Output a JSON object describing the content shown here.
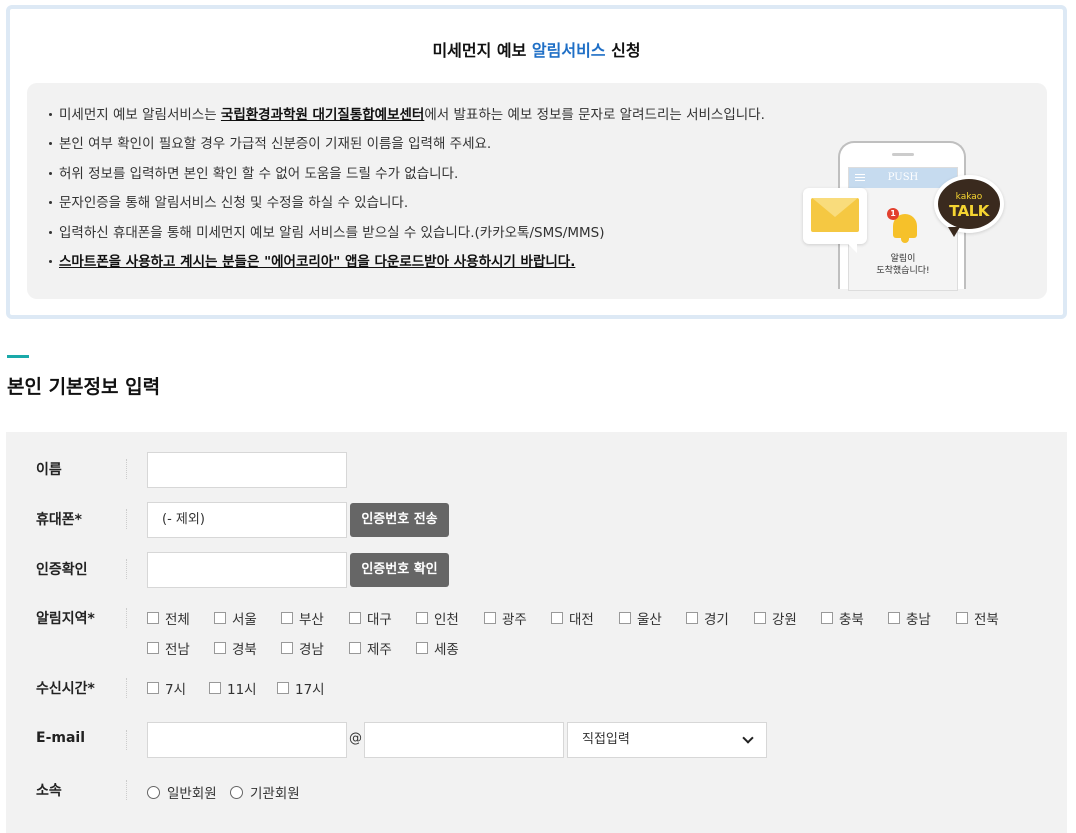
{
  "notice": {
    "title_prefix": "미세먼지 예보 ",
    "title_accent": "알림서비스",
    "title_suffix": " 신청",
    "items": [
      {
        "pre": "미세먼지 예보 알림서비스는 ",
        "strong": "국립환경과학원 대기질통합예보센터",
        "post": "에서 발표하는 예보 정보를 문자로 알려드리는 서비스입니다."
      },
      {
        "pre": "본인 여부 확인이 필요할 경우 가급적 신분증이 기재된 이름을 입력해 주세요.",
        "strong": "",
        "post": ""
      },
      {
        "pre": "허위 정보를 입력하면 본인 확인 할 수 없어 도움을 드릴 수가 없습니다.",
        "strong": "",
        "post": ""
      },
      {
        "pre": "문자인증을 통해 알림서비스 신청 및 수정을 하실 수 있습니다.",
        "strong": "",
        "post": ""
      },
      {
        "pre": "입력하신 휴대폰을 통해 미세먼지 예보 알림 서비스를 받으실 수 있습니다.(카카오톡/SMS/MMS)",
        "strong": "",
        "post": ""
      }
    ],
    "bold_item": "스마트폰을 사용하고 계시는 분들은 \"에어코리아\" 앱을 다운로드받아 사용하시기 바랍니다.",
    "illustration": {
      "push_label": "PUSH",
      "badge": "1",
      "alarm_line1": "알림이",
      "alarm_line2": "도착했습니다!",
      "kakao_small": "kakao",
      "kakao_big": "TALK"
    }
  },
  "section": {
    "title": "본인 기본정보 입력"
  },
  "form": {
    "name": {
      "label": "이름",
      "value": ""
    },
    "phone": {
      "label": "휴대폰*",
      "value": "(- 제외)",
      "button": "인증번호 전송"
    },
    "verify": {
      "label": "인증확인",
      "value": "",
      "button": "인증번호 확인"
    },
    "region": {
      "label": "알림지역*",
      "options": [
        "전체",
        "서울",
        "부산",
        "대구",
        "인천",
        "광주",
        "대전",
        "울산",
        "경기",
        "강원",
        "충북",
        "충남",
        "전북",
        "전남",
        "경북",
        "경남",
        "제주",
        "세종"
      ]
    },
    "time": {
      "label": "수신시간*",
      "options": [
        "7시",
        "11시",
        "17시"
      ]
    },
    "email": {
      "label": "E-mail",
      "local": "",
      "at": "@",
      "domain": "",
      "select": "직접입력"
    },
    "affiliation": {
      "label": "소속",
      "options": [
        "일반회원",
        "기관회원"
      ]
    }
  },
  "colors": {
    "accent_blue": "#1f6fc6",
    "teal_mark": "#1aa9a9",
    "button_gray": "#666666",
    "form_bg": "#f2f2f2"
  }
}
